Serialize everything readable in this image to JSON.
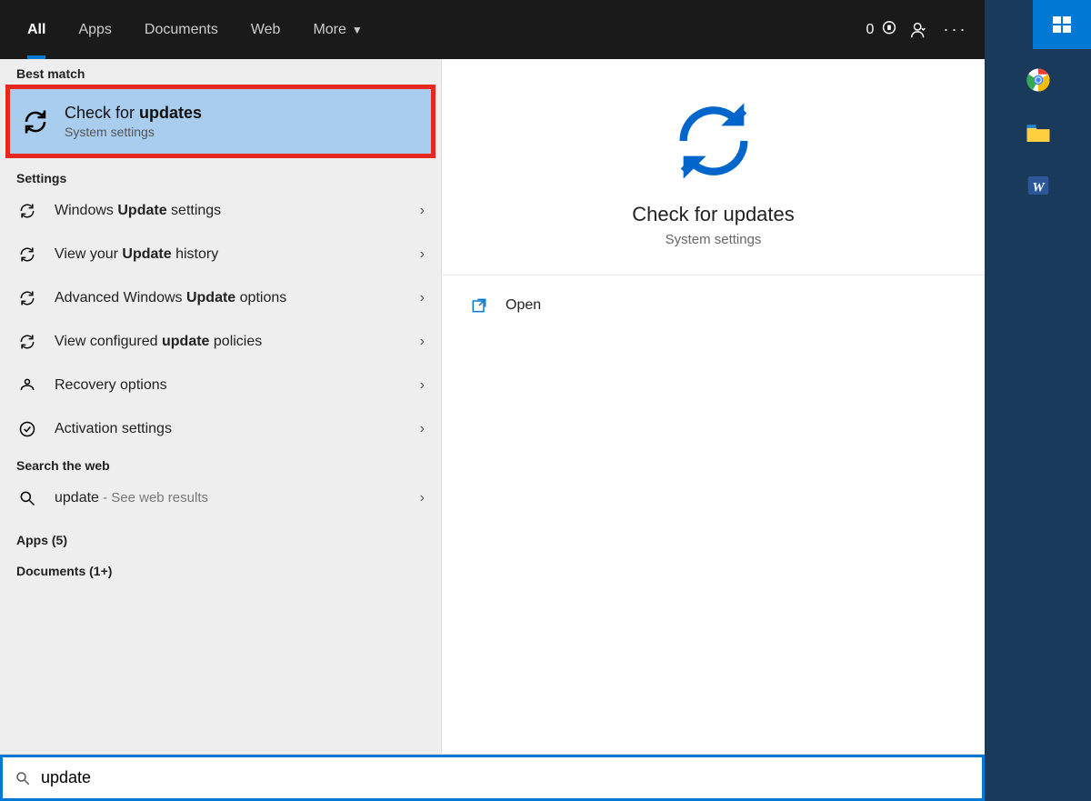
{
  "tabs": {
    "all": "All",
    "apps": "Apps",
    "documents": "Documents",
    "web": "Web",
    "more": "More"
  },
  "header": {
    "reward_count": "0"
  },
  "sections": {
    "best_match": "Best match",
    "settings": "Settings",
    "search_web": "Search the web",
    "apps_group": "Apps (5)",
    "documents_group": "Documents (1+)"
  },
  "best_match": {
    "title_pre": "Check for ",
    "title_bold": "updates",
    "subtitle": "System settings"
  },
  "settings_items": [
    {
      "pre": "Windows ",
      "bold": "Update",
      "post": " settings"
    },
    {
      "pre": "View your ",
      "bold": "Update",
      "post": " history"
    },
    {
      "pre": "Advanced Windows ",
      "bold": "Update",
      "post": " options"
    },
    {
      "pre": "View configured ",
      "bold": "update",
      "post": " policies"
    },
    {
      "pre": "Recovery options",
      "bold": "",
      "post": ""
    },
    {
      "pre": "Activation settings",
      "bold": "",
      "post": ""
    }
  ],
  "web_item": {
    "query": "update",
    "hint": " - See web results"
  },
  "detail": {
    "title": "Check for updates",
    "subtitle": "System settings",
    "open": "Open"
  },
  "search": {
    "value": "update"
  }
}
